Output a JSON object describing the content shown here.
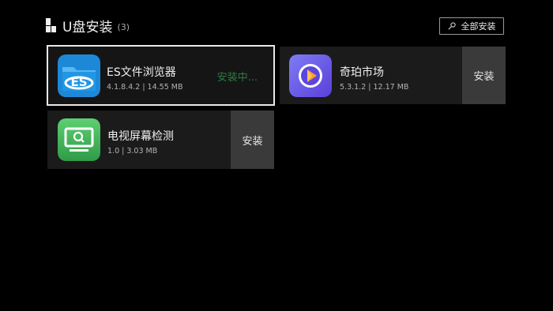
{
  "header": {
    "title": "U盘安装",
    "count": "(3)"
  },
  "install_all": {
    "label": "全部安装",
    "icon": "pin-icon"
  },
  "apps": [
    {
      "name": "ES文件浏览器",
      "meta": "4.1.8.4.2 | 14.55 MB",
      "status": "安装中...",
      "icon": "es-file-explorer-icon"
    },
    {
      "name": "奇珀市场",
      "meta": "5.3.1.2 | 12.17 MB",
      "button": "安装",
      "icon": "qipo-market-icon"
    },
    {
      "name": "电视屏幕检测",
      "meta": "1.0 | 3.03 MB",
      "button": "安装",
      "icon": "tv-screen-test-icon"
    }
  ],
  "colors": {
    "background": "#000000",
    "card": "#1b1b1b",
    "status_green": "#2f7a3f",
    "button": "#3a3a3a"
  }
}
